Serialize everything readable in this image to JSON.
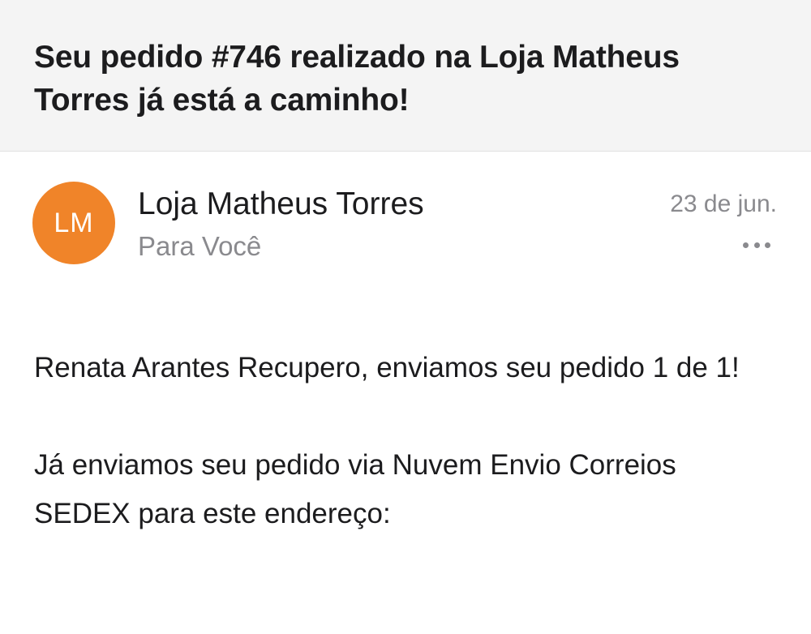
{
  "email": {
    "subject": "Seu pedido #746 realizado na Loja Matheus Torres já está a caminho!",
    "sender": {
      "initials": "LM",
      "name": "Loja Matheus Torres",
      "recipient": "Para Você",
      "date": "23 de jun.",
      "avatar_color": "#f08429"
    },
    "more_icon": "ellipsis-icon",
    "body": {
      "paragraph_1": "Renata Arantes Recupero, enviamos seu pedido 1 de 1!",
      "paragraph_2": "Já enviamos seu pedido via Nuvem Envio Correios SEDEX para este endereço:"
    }
  }
}
